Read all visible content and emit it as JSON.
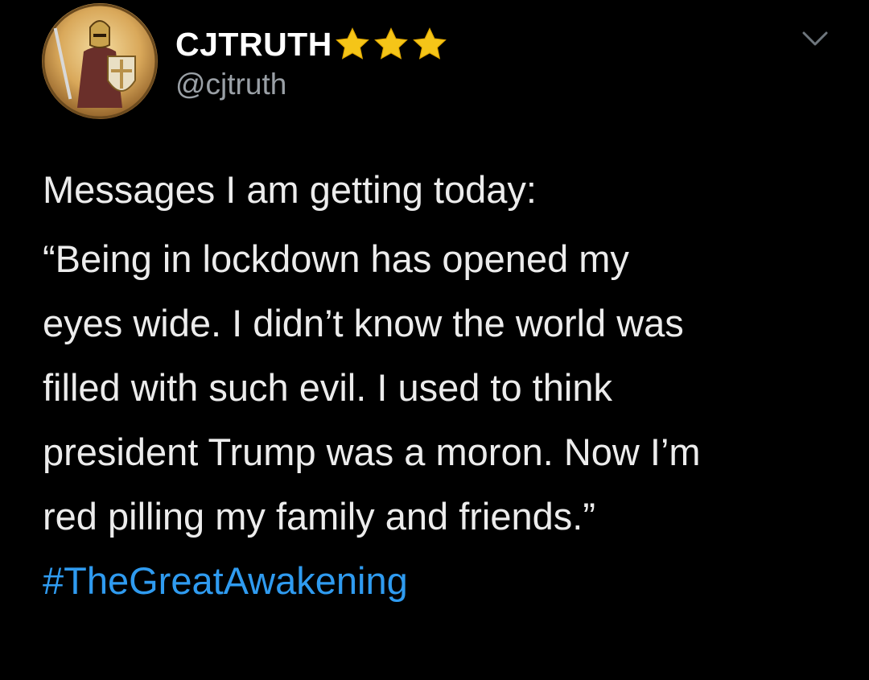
{
  "user": {
    "display_name": "CJTRUTH",
    "badge_icons": [
      "star-icon",
      "star-icon",
      "star-icon"
    ],
    "badge_color": "#f5c518",
    "handle": "@cjtruth",
    "avatar_icon": "knight-avatar"
  },
  "menu": {
    "icon": "chevron-down-icon"
  },
  "tweet": {
    "intro": "Messages I am getting today:",
    "quote_lines": [
      "“Being in lockdown has opened my",
      "eyes wide. I didn’t know the world was",
      "filled with such evil. I used to think",
      "president Trump was a moron. Now I’m",
      "red pilling my family and friends.”"
    ],
    "hashtag": "#TheGreatAwakening",
    "hashtag_color": "#2f9bf0"
  }
}
